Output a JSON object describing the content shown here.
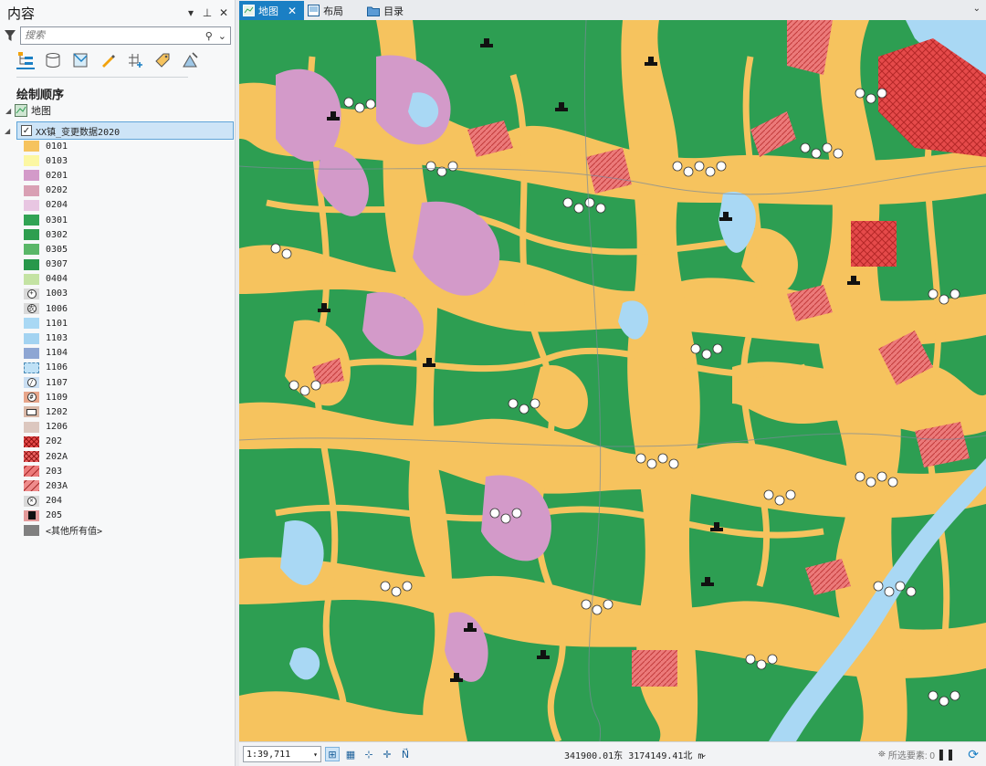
{
  "pane": {
    "title": "内容",
    "search_placeholder": "搜索",
    "section_title": "绘制顺序",
    "map_node": "地图",
    "layer_name": "XX镇_变更数据2020"
  },
  "legend": [
    {
      "code": "0101",
      "fill": "#f6c35e",
      "kind": "solid"
    },
    {
      "code": "0103",
      "fill": "#fcf7a2",
      "kind": "solid"
    },
    {
      "code": "0201",
      "fill": "#d39ac9",
      "kind": "solid"
    },
    {
      "code": "0202",
      "fill": "#d9a0b4",
      "kind": "solid"
    },
    {
      "code": "0204",
      "fill": "#e8c6e2",
      "kind": "solid"
    },
    {
      "code": "0301",
      "fill": "#31a354",
      "kind": "solid"
    },
    {
      "code": "0302",
      "fill": "#2e9e4f",
      "kind": "solid"
    },
    {
      "code": "0305",
      "fill": "#5ab768",
      "kind": "solid"
    },
    {
      "code": "0307",
      "fill": "#28984b",
      "kind": "solid"
    },
    {
      "code": "0404",
      "fill": "#c4e3a3",
      "kind": "solid"
    },
    {
      "code": "1003",
      "fill": "#d9d9d9",
      "kind": "circle-cross"
    },
    {
      "code": "1006",
      "fill": "#d9d9d9",
      "kind": "circle-text"
    },
    {
      "code": "1101",
      "fill": "#a9d8f4",
      "kind": "solid"
    },
    {
      "code": "1103",
      "fill": "#a3d3f1",
      "kind": "solid"
    },
    {
      "code": "1104",
      "fill": "#8ea6d3",
      "kind": "solid"
    },
    {
      "code": "1106",
      "fill": "#bfe1f6",
      "kind": "dotted"
    },
    {
      "code": "1107",
      "fill": "#c9def2",
      "kind": "circle-slash"
    },
    {
      "code": "1109",
      "fill": "#e7a58a",
      "kind": "circle-grid"
    },
    {
      "code": "1202",
      "fill": "#d9b8a7",
      "kind": "greenhouse"
    },
    {
      "code": "1206",
      "fill": "#dcc7bf",
      "kind": "solid"
    },
    {
      "code": "202",
      "fill": "#e54a4a",
      "kind": "crosshatch"
    },
    {
      "code": "202A",
      "fill": "#e96060",
      "kind": "crosshatch"
    },
    {
      "code": "203",
      "fill": "#ec7a7a",
      "kind": "hatch"
    },
    {
      "code": "203A",
      "fill": "#ee8b8b",
      "kind": "hatch"
    },
    {
      "code": "204",
      "fill": "#d9d9d9",
      "kind": "circle-x"
    },
    {
      "code": "205",
      "fill": "#e39a9a",
      "kind": "building"
    },
    {
      "code": "<其他所有值>",
      "fill": "#808080",
      "kind": "solid"
    }
  ],
  "tabs": [
    {
      "label": "地图",
      "active": true
    },
    {
      "label": "布局",
      "active": false
    },
    {
      "label": "目录",
      "active": false
    }
  ],
  "status": {
    "scale": "1:39,711",
    "coordinates": "341900.01东  3174149.41北 m",
    "selected": "所选要素: 0"
  },
  "colors": {
    "accent": "#1a7fc4",
    "forest": "#2d9e52",
    "cropland": "#f6c35e",
    "orchard": "#d39ac9",
    "water": "#a9d8f4",
    "urban": "#e54a4a"
  }
}
